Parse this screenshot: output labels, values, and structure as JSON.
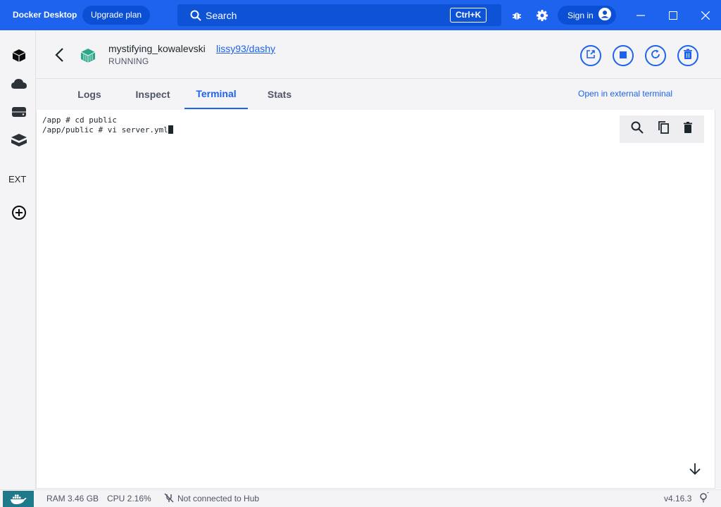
{
  "titlebar": {
    "app_title": "Docker Desktop",
    "upgrade_label": "Upgrade plan",
    "search_placeholder": "Search",
    "search_shortcut": "Ctrl+K",
    "signin_label": "Sign in",
    "brand_color": "#1d63ed"
  },
  "sidebar": {
    "items": [
      {
        "icon": "containers-icon"
      },
      {
        "icon": "images-cloud-icon"
      },
      {
        "icon": "volumes-icon"
      },
      {
        "icon": "dev-environments-icon"
      }
    ],
    "ext_label": "EXT",
    "add_extension_icon": "add-circle-icon"
  },
  "container": {
    "name": "mystifying_kowalevski",
    "image": "lissy93/dashy",
    "status": "RUNNING",
    "status_color": "#22a06b"
  },
  "actions": [
    {
      "icon": "open-in-browser-icon"
    },
    {
      "icon": "stop-icon"
    },
    {
      "icon": "restart-icon"
    },
    {
      "icon": "delete-icon"
    }
  ],
  "tabs": [
    {
      "label": "Logs"
    },
    {
      "label": "Inspect"
    },
    {
      "label": "Terminal",
      "active": true
    },
    {
      "label": "Stats"
    }
  ],
  "external_terminal_label": "Open in external terminal",
  "terminal": {
    "lines": [
      "/app # cd public",
      "/app/public # vi server.yml"
    ],
    "tools": [
      "search-icon",
      "copy-icon",
      "clear-icon"
    ]
  },
  "statusbar": {
    "ram": "RAM 3.46 GB",
    "cpu": "CPU 2.16%",
    "hub_status": "Not connected to Hub",
    "version": "v4.16.3"
  }
}
